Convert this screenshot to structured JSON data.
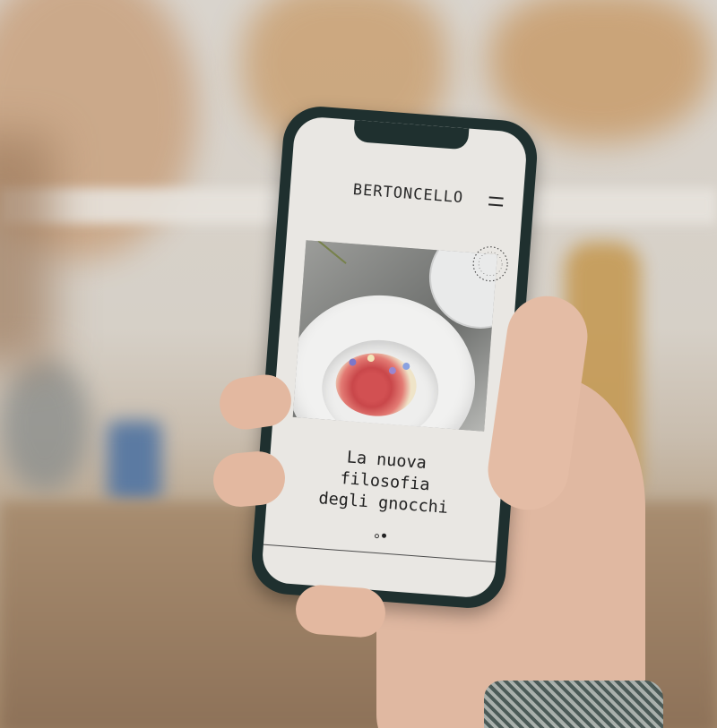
{
  "app": {
    "brand": "BERTONCELLO",
    "menu_icon": "hamburger-icon"
  },
  "hero": {
    "image_subject": "gnocchi-dish-photo",
    "stamp_icon": "circular-badge-icon",
    "headline_lines": [
      "La nuova",
      "filosofia",
      "degli gnocchi"
    ]
  },
  "carousel": {
    "slide_count": 2,
    "active_index": 1
  },
  "colors": {
    "screen_bg": "#e9e7e3",
    "text": "#222222",
    "phone_frame": "#1f302f",
    "accent_food": "#d25052"
  }
}
